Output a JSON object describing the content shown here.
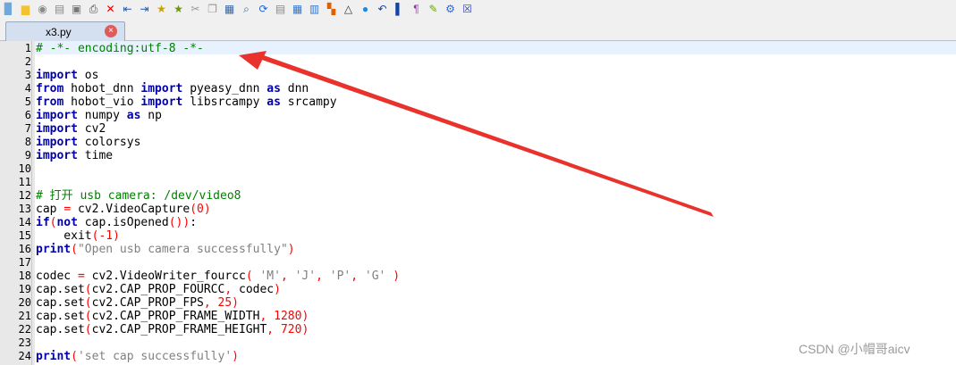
{
  "toolbar": {
    "icons": [
      "new-file-icon",
      "open-folder-icon",
      "save-icon",
      "save-all-icon",
      "close-icon",
      "print-icon",
      "delete-icon",
      "outdent-icon",
      "indent-icon",
      "bookmark-icon",
      "bookmark-next-icon",
      "cut-icon",
      "copy-icon",
      "paste-icon",
      "find-icon",
      "replace-icon",
      "macro-icon",
      "window-icon",
      "window-split-icon",
      "windows-logo-icon",
      "linux-logo-icon",
      "apple-logo-icon",
      "undo-icon",
      "column-icon",
      "pilcrow-icon",
      "highlight-icon",
      "settings-icon",
      "close-window-icon"
    ]
  },
  "tab": {
    "label": "x3.py",
    "close": "×"
  },
  "lines": [
    {
      "n": "1",
      "code": "# -*- encoding:utf-8 -*-"
    },
    {
      "n": "2",
      "code": ""
    },
    {
      "n": "3",
      "code": "import os"
    },
    {
      "n": "4",
      "code": "from hobot_dnn import pyeasy_dnn as dnn"
    },
    {
      "n": "5",
      "code": "from hobot_vio import libsrcampy as srcampy"
    },
    {
      "n": "6",
      "code": "import numpy as np"
    },
    {
      "n": "7",
      "code": "import cv2"
    },
    {
      "n": "8",
      "code": "import colorsys"
    },
    {
      "n": "9",
      "code": "import time"
    },
    {
      "n": "10",
      "code": ""
    },
    {
      "n": "11",
      "code": ""
    },
    {
      "n": "12",
      "code": "# 打开 usb camera: /dev/video8"
    },
    {
      "n": "13",
      "code": "cap = cv2.VideoCapture(0)"
    },
    {
      "n": "14",
      "code": "if(not cap.isOpened()):"
    },
    {
      "n": "15",
      "code": "    exit(-1)"
    },
    {
      "n": "16",
      "code": "print(\"Open usb camera successfully\")"
    },
    {
      "n": "17",
      "code": ""
    },
    {
      "n": "18",
      "code": "codec = cv2.VideoWriter_fourcc( 'M', 'J', 'P', 'G' )"
    },
    {
      "n": "19",
      "code": "cap.set(cv2.CAP_PROP_FOURCC, codec)"
    },
    {
      "n": "20",
      "code": "cap.set(cv2.CAP_PROP_FPS, 25)"
    },
    {
      "n": "21",
      "code": "cap.set(cv2.CAP_PROP_FRAME_WIDTH, 1280)"
    },
    {
      "n": "22",
      "code": "cap.set(cv2.CAP_PROP_FRAME_HEIGHT, 720)"
    },
    {
      "n": "23",
      "code": ""
    },
    {
      "n": "24",
      "code": "print('set cap successfully')"
    }
  ],
  "watermark": "CSDN @小帽哥aicv",
  "colors": {
    "keyword": "#0000b0",
    "string": "#808080",
    "comment": "#008000",
    "number": "#ff0000",
    "arrow": "#e8322b"
  }
}
